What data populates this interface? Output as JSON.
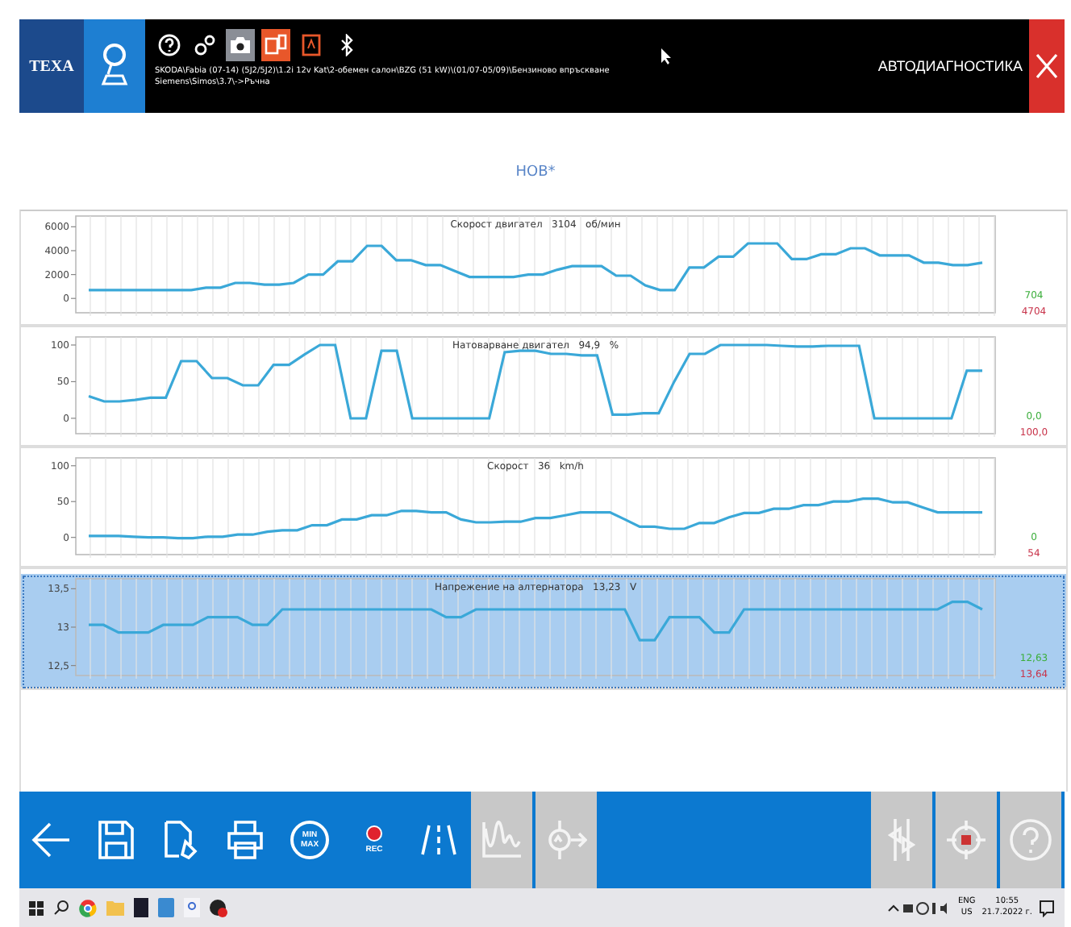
{
  "header": {
    "logo": "TEXA",
    "icons": [
      {
        "kind": "help",
        "selected": false
      },
      {
        "kind": "gears",
        "selected": false
      },
      {
        "kind": "camera",
        "selected": true
      },
      {
        "kind": "device",
        "selected": false
      },
      {
        "kind": "report",
        "selected": false
      },
      {
        "kind": "bluetooth",
        "selected": false
      }
    ],
    "vehicle_lines": [
      "SKODA\\Fabia (07-14) (5J2/5J2)\\1.2i 12v Kat\\2-обемен салон\\BZG (51 kW)\\(01/07-05/09)\\Бензиново впръскване",
      "Siemens\\Simos\\3.7\\->Ръчна"
    ],
    "title": "АВТОДИАГНОСТИКА"
  },
  "document_title": "НОВ*",
  "charts": [
    {
      "selected": false,
      "min": "704",
      "max": "4704",
      "chart_data": {
        "type": "line",
        "title": "Скорост двигател   3104   об/мин",
        "ylim": [
          -1200,
          6900
        ],
        "yticks": [
          0,
          2000,
          4000,
          6000
        ],
        "grid": true,
        "series": [
          {
            "color": "#3aa8d8",
            "values": [
              700,
              700,
              700,
              700,
              700,
              700,
              700,
              700,
              900,
              900,
              1300,
              1300,
              1150,
              1150,
              1300,
              2000,
              2000,
              3100,
              3100,
              4400,
              4400,
              3200,
              3200,
              2800,
              2800,
              2300,
              1800,
              1800,
              1800,
              1800,
              2000,
              2000,
              2400,
              2700,
              2700,
              2700,
              1900,
              1900,
              1100,
              700,
              700,
              2600,
              2600,
              3500,
              3500,
              4600,
              4600,
              4600,
              3300,
              3300,
              3700,
              3700,
              4200,
              4200,
              3600,
              3600,
              3600,
              3000,
              3000,
              2800,
              2800,
              3000
            ]
          }
        ]
      }
    },
    {
      "selected": false,
      "min": "0,0",
      "max": "100,0",
      "chart_data": {
        "type": "line",
        "title": "Натоварване двигател   94,9   %",
        "ylim": [
          -21,
          111
        ],
        "yticks": [
          0,
          50,
          100
        ],
        "grid": true,
        "series": [
          {
            "color": "#3aa8d8",
            "values": [
              30,
              23,
              23,
              25,
              28,
              28,
              78,
              78,
              55,
              55,
              45,
              45,
              73,
              73,
              87,
              100,
              100,
              0,
              0,
              92,
              92,
              0,
              0,
              0,
              0,
              0,
              0,
              90,
              92,
              92,
              88,
              88,
              86,
              86,
              5,
              5,
              7,
              7,
              50,
              88,
              88,
              100,
              100,
              100,
              100,
              99,
              98,
              98,
              99,
              99,
              99,
              0,
              0,
              0,
              0,
              0,
              0,
              65,
              65
            ]
          }
        ]
      }
    },
    {
      "selected": false,
      "min": "0",
      "max": "54",
      "chart_data": {
        "type": "line",
        "title": "Скорост   36   km/h",
        "ylim": [
          -24,
          111
        ],
        "yticks": [
          0,
          50,
          100
        ],
        "grid": true,
        "series": [
          {
            "color": "#3aa8d8",
            "values": [
              2,
              2,
              2,
              1,
              0,
              0,
              -1,
              -1,
              1,
              1,
              4,
              4,
              8,
              10,
              10,
              17,
              17,
              25,
              25,
              31,
              31,
              37,
              37,
              35,
              35,
              25,
              21,
              21,
              22,
              22,
              27,
              27,
              31,
              35,
              35,
              35,
              25,
              15,
              15,
              12,
              12,
              20,
              20,
              28,
              34,
              34,
              40,
              40,
              45,
              45,
              50,
              50,
              54,
              54,
              49,
              49,
              42,
              35,
              35,
              35,
              35
            ]
          }
        ]
      }
    },
    {
      "selected": true,
      "min": "12,63",
      "max": "13,64",
      "chart_data": {
        "type": "line",
        "title": "Напрежение на алтернатора   13,23   V",
        "ylim": [
          12.37,
          13.63
        ],
        "yticks": [
          {
            "value": 12.5,
            "label": "12,5"
          },
          {
            "value": 13,
            "label": "13"
          },
          {
            "value": 13.5,
            "label": "13,5"
          }
        ],
        "grid": true,
        "series": [
          {
            "color": "#3aa8d8",
            "values": [
              13.03,
              13.03,
              12.93,
              12.93,
              12.93,
              13.03,
              13.03,
              13.03,
              13.13,
              13.13,
              13.13,
              13.03,
              13.03,
              13.23,
              13.23,
              13.23,
              13.23,
              13.23,
              13.23,
              13.23,
              13.23,
              13.23,
              13.23,
              13.23,
              13.13,
              13.13,
              13.23,
              13.23,
              13.23,
              13.23,
              13.23,
              13.23,
              13.23,
              13.23,
              13.23,
              13.23,
              13.23,
              12.83,
              12.83,
              13.13,
              13.13,
              13.13,
              12.93,
              12.93,
              13.23,
              13.23,
              13.23,
              13.23,
              13.23,
              13.23,
              13.23,
              13.23,
              13.23,
              13.23,
              13.23,
              13.23,
              13.23,
              13.23,
              13.33,
              13.33,
              13.23
            ]
          }
        ]
      }
    }
  ],
  "toolbar": {
    "left": [
      {
        "kind": "back",
        "disabled": false
      },
      {
        "kind": "save",
        "disabled": false
      },
      {
        "kind": "export",
        "disabled": false
      },
      {
        "kind": "print",
        "disabled": false
      },
      {
        "kind": "minmax",
        "label": "MIN MAX",
        "disabled": false
      },
      {
        "kind": "rec",
        "label": "REC",
        "disabled": false
      },
      {
        "kind": "lanes",
        "disabled": false
      },
      {
        "kind": "graph",
        "disabled": true
      },
      {
        "kind": "signal",
        "disabled": true
      }
    ],
    "right": [
      {
        "kind": "cursor",
        "disabled": true
      },
      {
        "kind": "target",
        "disabled": true
      },
      {
        "kind": "help",
        "disabled": true
      }
    ]
  },
  "taskbar": {
    "language": "ENG",
    "layout": "US",
    "time": "10:55",
    "date": "21.7.2022 г."
  }
}
